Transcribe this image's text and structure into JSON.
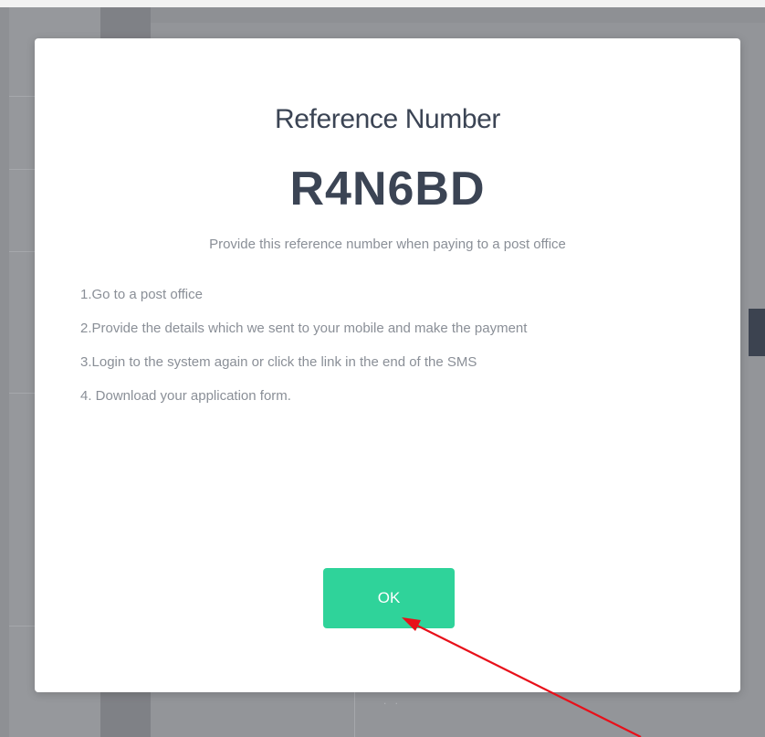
{
  "modal": {
    "heading": "Reference Number",
    "reference_code": "R4N6BD",
    "subtitle": "Provide this reference number when paying to a post office",
    "steps": [
      "1.Go to a post office",
      "2.Provide the details which we sent to your mobile and make the payment",
      "3.Login to the system again or click the link in the end of the SMS",
      "4. Download your application form."
    ],
    "ok_label": "OK"
  },
  "background": {
    "dots": ". ."
  },
  "colors": {
    "heading": "#3b4454",
    "body_text": "#8a8f97",
    "button": "#2fd39a",
    "annotation": "#e8101a"
  },
  "annotation": {
    "arrow_icon": "red-arrow-icon"
  }
}
